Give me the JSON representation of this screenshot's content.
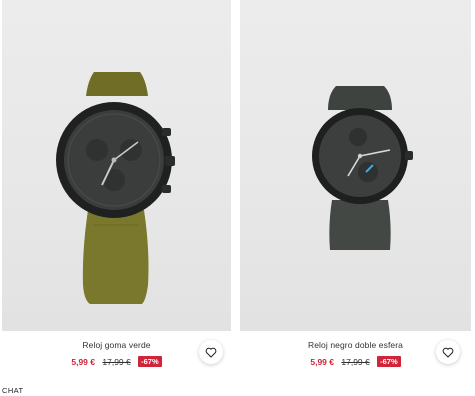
{
  "products": [
    {
      "name": "Reloj goma verde",
      "price_now": "5,99 €",
      "price_old": "17,99 €",
      "discount": "-67%",
      "strap_color": "#76742a",
      "dial_color": "#3a3d3c"
    },
    {
      "name": "Reloj negro doble esfera",
      "price_now": "5,99 €",
      "price_old": "17,99 €",
      "discount": "-67%",
      "strap_color": "#3f433f",
      "dial_color": "#3c3f3e"
    }
  ],
  "favorite_icon": "heart-icon",
  "footer": {
    "chat_label": "CHAT"
  },
  "colors": {
    "sale_red": "#d0243a",
    "page_bg": "#ffffff"
  }
}
